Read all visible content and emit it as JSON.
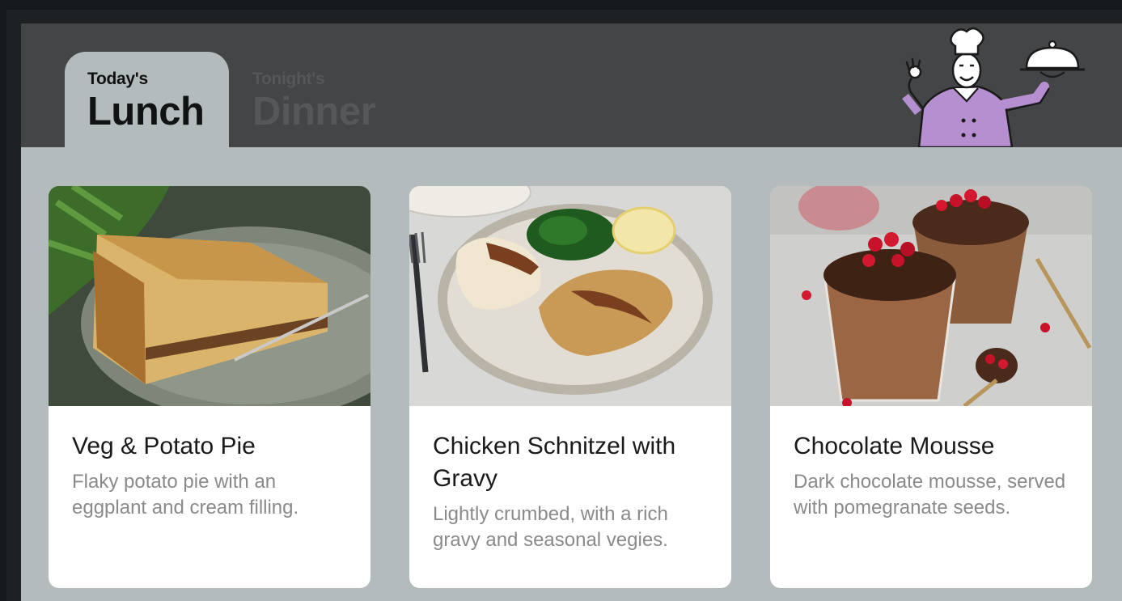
{
  "tabs": [
    {
      "small": "Today's",
      "big": "Lunch",
      "active": true
    },
    {
      "small": "Tonight's",
      "big": "Dinner",
      "active": false
    }
  ],
  "illustration": {
    "icon": "chef-holding-cloche-icon",
    "accent": "#b58fcf"
  },
  "colors": {
    "header": "#444546",
    "body": "#b3bbbd",
    "card": "#ffffff"
  },
  "dishes": [
    {
      "title": "Veg & Potato Pie",
      "description": "Flaky potato pie with an eggplant and cream filling.",
      "photo": "potato-pie-photo"
    },
    {
      "title": "Chicken Schnitzel with Gravy",
      "description": "Lightly crumbed, with a rich gravy and seasonal vegies.",
      "photo": "schnitzel-photo"
    },
    {
      "title": "Chocolate Mousse",
      "description": "Dark chocolate mousse, served with pomegranate seeds.",
      "photo": "chocolate-mousse-photo"
    }
  ]
}
